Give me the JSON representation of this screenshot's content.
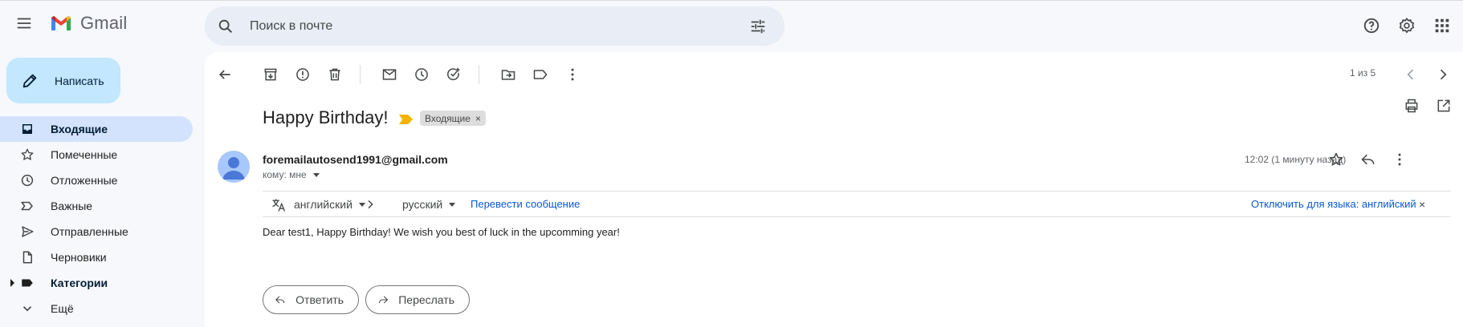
{
  "app": {
    "name": "Gmail"
  },
  "header": {
    "main_menu": "menu-icon",
    "search_placeholder": "Поиск в почте",
    "icons": [
      "search-icon",
      "filter-options-icon",
      "help-icon",
      "settings-icon",
      "apps-icon"
    ]
  },
  "sidebar": {
    "compose_label": "Написать",
    "items": [
      {
        "label": "Входящие",
        "icon": "inbox-icon",
        "active": true
      },
      {
        "label": "Помеченные",
        "icon": "star-icon"
      },
      {
        "label": "Отложенные",
        "icon": "clock-icon"
      },
      {
        "label": "Важные",
        "icon": "important-icon"
      },
      {
        "label": "Отправленные",
        "icon": "send-icon"
      },
      {
        "label": "Черновики",
        "icon": "draft-icon"
      },
      {
        "label": "Категории",
        "icon": "label-icon",
        "bold": true
      },
      {
        "label": "Ещё",
        "icon": "chevron-down-icon"
      }
    ]
  },
  "toolbar": {
    "icons": [
      "back-icon",
      "archive-icon",
      "report-spam-icon",
      "delete-icon",
      "mark-unread-icon",
      "snooze-icon",
      "add-task-icon",
      "move-to-icon",
      "labels-icon",
      "more-vert-icon"
    ],
    "pager": "1 из 5"
  },
  "message": {
    "subject": "Happy Birthday!",
    "label_chip": "Входящие",
    "label_chip_close": "×",
    "sender": "foremailautosend1991@gmail.com",
    "to": "кому: мне",
    "time": "12:02 (1 минуту назад)",
    "body": "Dear test1, Happy Birthday! We wish you best of luck in the upcomming year!"
  },
  "translation": {
    "source_lang": "английский",
    "target_lang": "русский",
    "translate_link": "Перевести сообщение",
    "disable_link": "Отключить для языка: английский",
    "close": "×"
  },
  "actions": {
    "reply": "Ответить",
    "forward": "Переслать"
  },
  "colors": {
    "background": "#f6f8fc",
    "compose": "#c2e7ff",
    "active_nav": "#d3e3fd",
    "link": "#0b57d0",
    "important_marker": "#f4b400"
  }
}
